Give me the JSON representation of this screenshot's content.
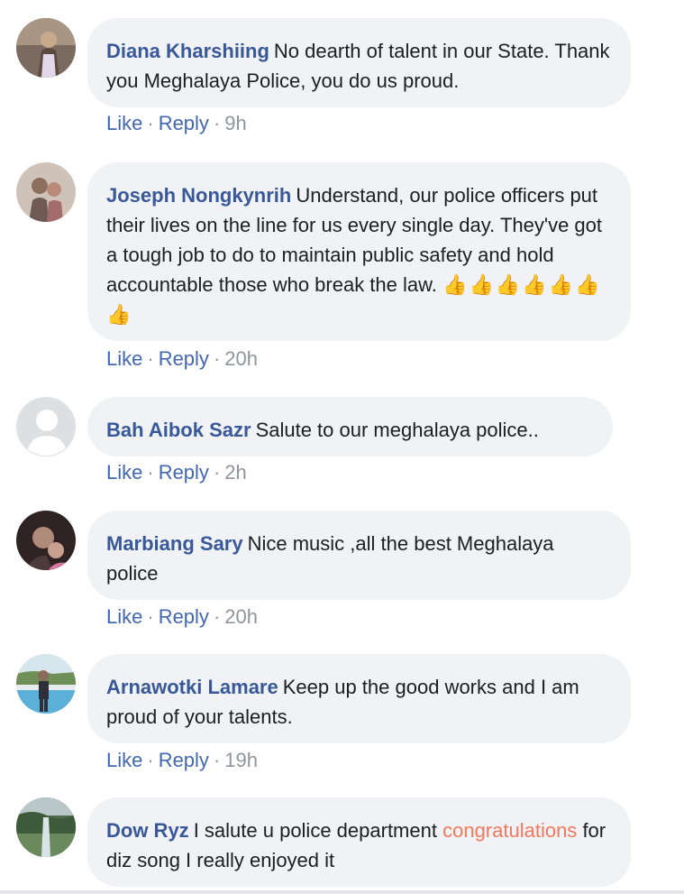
{
  "comments": [
    {
      "author": "Diana Kharshiing",
      "text": "No dearth of talent in our State. Thank you Meghalaya Police, you do us proud.",
      "like_label": "Like",
      "reply_label": "Reply",
      "time": "9h",
      "avatar_colors": [
        "#5b4a42",
        "#c9a98b"
      ]
    },
    {
      "author": "Joseph Nongkynrih",
      "text": "Understand, our police officers put their lives on the line for us every single day. They've got a tough job to do to maintain public safety and hold accountable those who break the law.",
      "emoji": "👍👍👍👍👍👍👍",
      "like_label": "Like",
      "reply_label": "Reply",
      "time": "20h",
      "avatar_colors": [
        "#8c6f5c",
        "#d9c2b0"
      ]
    },
    {
      "author": "Bah Aibok Sazr",
      "text": "Salute to our meghalaya police..",
      "like_label": "Like",
      "reply_label": "Reply",
      "time": "2h",
      "avatar_colors": [
        "#dddfe2",
        "#ffffff"
      ]
    },
    {
      "author": "Marbiang Sary",
      "text": "Nice music ,all the best Meghalaya police",
      "like_label": "Like",
      "reply_label": "Reply",
      "time": "20h",
      "avatar_colors": [
        "#3a2c2a",
        "#b08a7a"
      ]
    },
    {
      "author": "Arnawotki Lamare",
      "text": "Keep up the good works and I am proud of your talents.",
      "like_label": "Like",
      "reply_label": "Reply",
      "time": "19h",
      "avatar_colors": [
        "#6f9fc9",
        "#4f6b3d"
      ]
    },
    {
      "author": "Dow Ryz",
      "text_before": "I salute u police department",
      "highlight": "congratulations",
      "text_after": "for diz song I really enjoyed it",
      "avatar_colors": [
        "#3d5a3a",
        "#8aa37a"
      ]
    }
  ],
  "colors": {
    "author_link": "#385898",
    "action_link": "#4267b2",
    "bubble_bg": "#f0f2f5",
    "highlight": "#f0795d"
  }
}
